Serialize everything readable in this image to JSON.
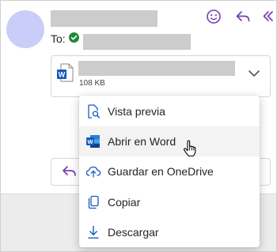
{
  "message": {
    "to_label": "To:",
    "header_actions": [
      {
        "icon": "emoji-icon"
      },
      {
        "icon": "reply-icon"
      },
      {
        "icon": "reply-all-icon"
      }
    ]
  },
  "attachment": {
    "size": "108 KB",
    "icon": "word-file-icon"
  },
  "menu": {
    "items": [
      {
        "label": "Vista previa",
        "icon": "preview-icon"
      },
      {
        "label": "Abrir en Word",
        "icon": "word-icon"
      },
      {
        "label": "Guardar en OneDrive",
        "icon": "cloud-upload-icon"
      },
      {
        "label": "Copiar",
        "icon": "copy-icon"
      },
      {
        "label": "Descargar",
        "icon": "download-icon"
      }
    ]
  },
  "colors": {
    "accent": "#7b3db1",
    "word_blue": "#185abd",
    "verified_green": "#1f8a3b",
    "avatar": "#c9cdf7"
  }
}
